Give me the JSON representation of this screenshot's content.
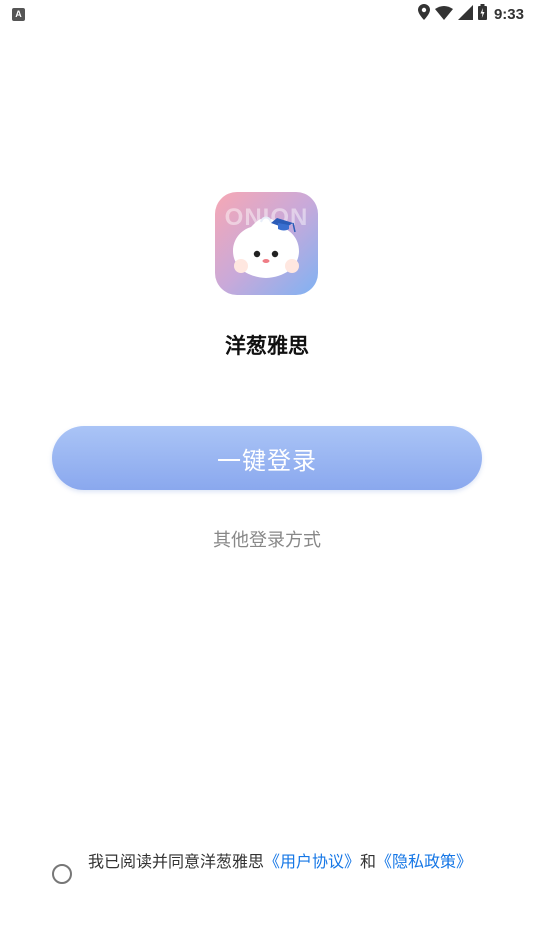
{
  "status_bar": {
    "time": "9:33",
    "left_icon": "A",
    "icons": [
      "location-icon",
      "wifi-icon",
      "signal-icon",
      "battery-icon"
    ]
  },
  "app": {
    "logo_watermark": "ONION",
    "name": "洋葱雅思"
  },
  "login": {
    "one_click_label": "一键登录",
    "other_methods_label": "其他登录方式"
  },
  "agreement": {
    "prefix": "我已阅读并同意洋葱雅思",
    "user_agreement": "《用户协议》",
    "conjunction": "和",
    "privacy_policy": "《隐私政策》"
  },
  "colors": {
    "button_top": "#aac4f6",
    "button_bottom": "#8aa8ee",
    "link": "#1677e6",
    "secondary_text": "#888888"
  }
}
